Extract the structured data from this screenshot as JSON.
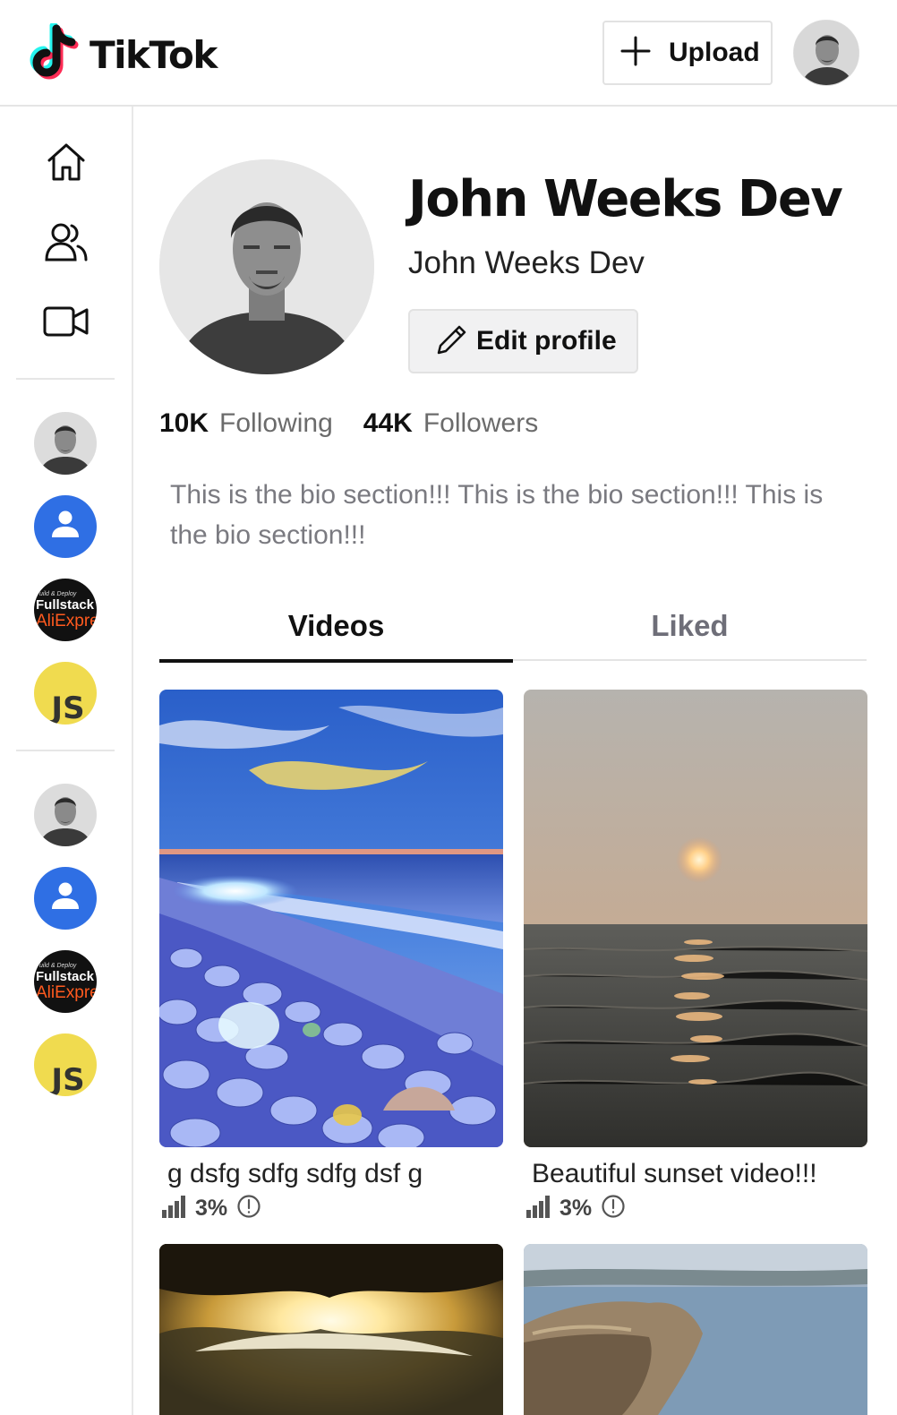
{
  "header": {
    "brand": "TikTok",
    "upload_label": "Upload"
  },
  "sidebar": {
    "nav": [
      {
        "name": "home",
        "icon": "home-icon"
      },
      {
        "name": "following",
        "icon": "users-icon"
      },
      {
        "name": "live",
        "icon": "video-camera-icon"
      }
    ],
    "accounts_group_1": [
      {
        "type": "photo"
      },
      {
        "type": "default-avatar"
      },
      {
        "type": "fullstack",
        "line1": "uild & Deploy",
        "line2": "Fullstack",
        "line3": "AliExpre"
      },
      {
        "type": "js",
        "text": "JS"
      }
    ],
    "accounts_group_2": [
      {
        "type": "photo"
      },
      {
        "type": "default-avatar"
      },
      {
        "type": "fullstack",
        "line1": "uild & Deploy",
        "line2": "Fullstack",
        "line3": "AliExpre"
      },
      {
        "type": "js",
        "text": "JS"
      }
    ]
  },
  "profile": {
    "name": "John Weeks Dev",
    "username": "John Weeks Dev",
    "edit_label": "Edit profile",
    "following_count": "10K",
    "following_label": "Following",
    "followers_count": "44K",
    "followers_label": "Followers",
    "bio": "This is the bio section!!! This is the bio section!!! This is the bio section!!!"
  },
  "tabs": [
    {
      "label": "Videos",
      "active": true
    },
    {
      "label": "Liked",
      "active": false
    }
  ],
  "videos": [
    {
      "title": "g dsfg sdfg sdfg dsf g",
      "percent": "3%",
      "scene": "beach-pebbles"
    },
    {
      "title": "Beautiful sunset video!!!",
      "percent": "3%",
      "scene": "sea-sunset"
    },
    {
      "title": "",
      "percent": "",
      "scene": "sun-clouds"
    },
    {
      "title": "",
      "percent": "",
      "scene": "cliff-lake"
    }
  ],
  "colors": {
    "accent_blue": "#2f6fe4",
    "tiktok_cyan": "#25f4ee",
    "tiktok_pink": "#fe2c55",
    "js_yellow": "#f0db4f",
    "muted_text": "#7a7a80"
  }
}
